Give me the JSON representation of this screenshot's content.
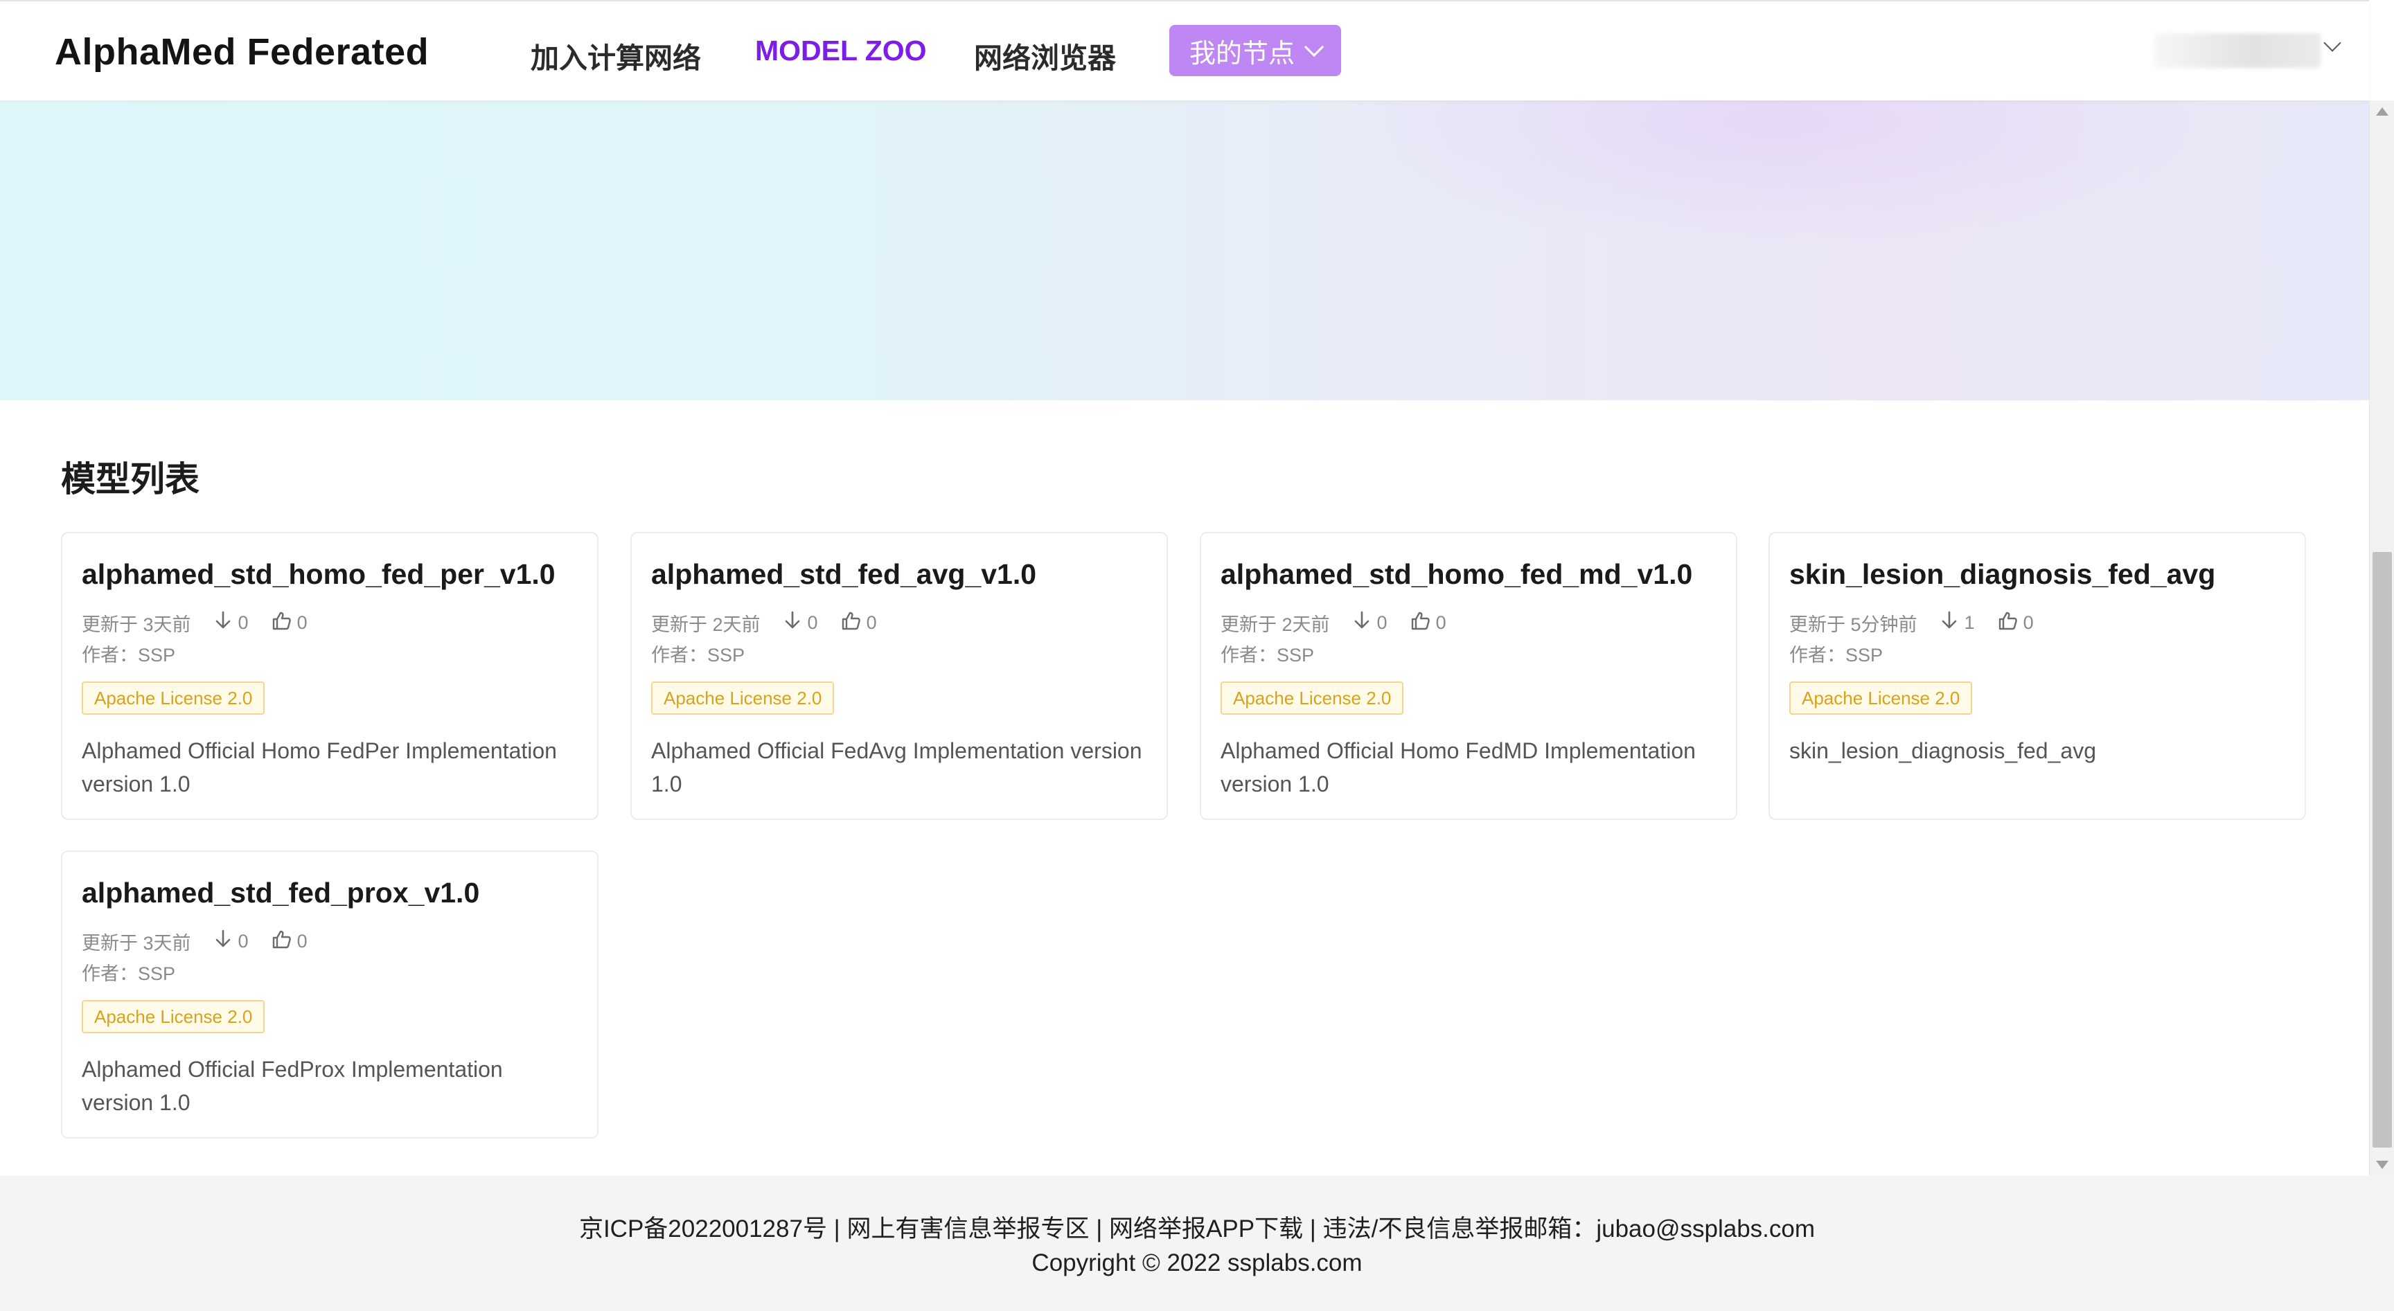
{
  "header": {
    "brand": "AlphaMed Federated",
    "nav": [
      {
        "label": "加入计算网络",
        "active": false
      },
      {
        "label": "MODEL ZOO",
        "active": true
      },
      {
        "label": "网络浏览器",
        "active": false
      }
    ],
    "node_button": "我的节点",
    "accent_color": "#7c1ee6",
    "button_color": "#bf87f3"
  },
  "main": {
    "section_title": "模型列表",
    "author_prefix": "作者：",
    "cards": [
      {
        "title": "alphamed_std_homo_fed_per_v1.0",
        "updated": "更新于 3天前",
        "downloads": "0",
        "likes": "0",
        "author": "SSP",
        "license": "Apache License 2.0",
        "description": "Alphamed Official Homo FedPer Implementation version 1.0"
      },
      {
        "title": "alphamed_std_fed_avg_v1.0",
        "updated": "更新于 2天前",
        "downloads": "0",
        "likes": "0",
        "author": "SSP",
        "license": "Apache License 2.0",
        "description": "Alphamed Official FedAvg Implementation version 1.0"
      },
      {
        "title": "alphamed_std_homo_fed_md_v1.0",
        "updated": "更新于 2天前",
        "downloads": "0",
        "likes": "0",
        "author": "SSP",
        "license": "Apache License 2.0",
        "description": "Alphamed Official Homo FedMD Implementation version 1.0"
      },
      {
        "title": "skin_lesion_diagnosis_fed_avg",
        "updated": "更新于 5分钟前",
        "downloads": "1",
        "likes": "0",
        "author": "SSP",
        "license": "Apache License 2.0",
        "description": "skin_lesion_diagnosis_fed_avg"
      },
      {
        "title": "alphamed_std_fed_prox_v1.0",
        "updated": "更新于 3天前",
        "downloads": "0",
        "likes": "0",
        "author": "SSP",
        "license": "Apache License 2.0",
        "description": "Alphamed Official FedProx Implementation version 1.0"
      }
    ],
    "license_color": "#d7a31a"
  },
  "footer": {
    "line1": "京ICP备2022001287号 | 网上有害信息举报专区 | 网络举报APP下载 | 违法/不良信息举报邮箱：jubao@ssplabs.com",
    "line2": "Copyright © 2022 ssplabs.com"
  }
}
